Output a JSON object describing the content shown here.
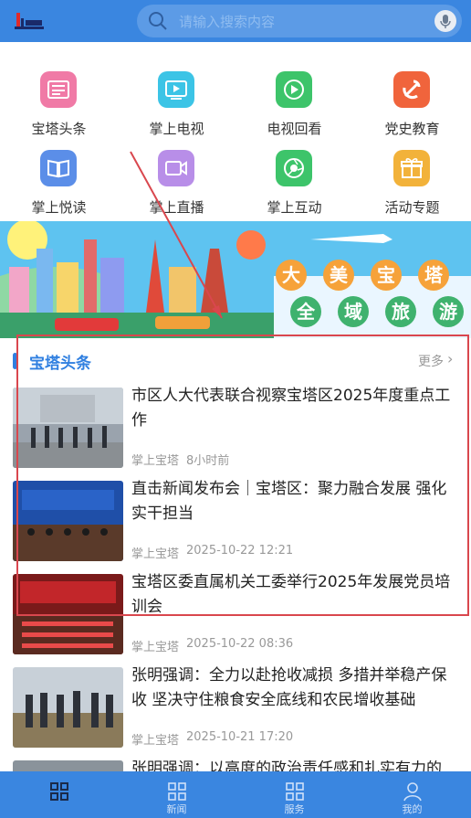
{
  "search": {
    "placeholder": "请输入搜索内容"
  },
  "grid": [
    {
      "label": "宝塔头条",
      "icon": "newspaper-icon",
      "color": "#f07aa6"
    },
    {
      "label": "掌上电视",
      "icon": "tv-icon",
      "color": "#3cc4e6"
    },
    {
      "label": "电视回看",
      "icon": "replay-icon",
      "color": "#3dc46a"
    },
    {
      "label": "党史教育",
      "icon": "party-emblem-icon",
      "color": "#f0643c"
    },
    {
      "label": "掌上悦读",
      "icon": "book-icon",
      "color": "#5b8ee8"
    },
    {
      "label": "掌上直播",
      "icon": "video-camera-icon",
      "color": "#b88ee8"
    },
    {
      "label": "掌上互动",
      "icon": "camera-shutter-icon",
      "color": "#3dc46a"
    },
    {
      "label": "活动专题",
      "icon": "gift-icon",
      "color": "#f2b23a"
    }
  ],
  "banner": {
    "chars": [
      "大",
      "美",
      "宝",
      "塔",
      "全",
      "域",
      "旅",
      "游"
    ]
  },
  "section": {
    "title": "宝塔头条",
    "more": "更多"
  },
  "news": [
    {
      "title": "市区人大代表联合视察宝塔区2025年度重点工作",
      "source": "掌上宝塔",
      "time": "8小时前"
    },
    {
      "title": "直击新闻发布会｜宝塔区：聚力融合发展 强化实干担当",
      "source": "掌上宝塔",
      "time": "2025-10-22 12:21"
    },
    {
      "title": "宝塔区委直属机关工委举行2025年发展党员培训会",
      "source": "掌上宝塔",
      "time": "2025-10-22 08:36"
    },
    {
      "title": "张明强调：全力以赴抢收减损 多措并举稳产保收 坚决守住粮食安全底线和农民增收基础",
      "source": "掌上宝塔",
      "time": "2025-10-21 17:20"
    },
    {
      "title": "张明强调：以高度的政治责任感和扎实有力的",
      "source": "",
      "time": ""
    }
  ],
  "tabs": [
    {
      "label": "",
      "icon": "home-grid-icon"
    },
    {
      "label": "新闻",
      "icon": "news-grid-icon"
    },
    {
      "label": "服务",
      "icon": "service-grid-icon"
    },
    {
      "label": "我的",
      "icon": "profile-icon"
    }
  ]
}
